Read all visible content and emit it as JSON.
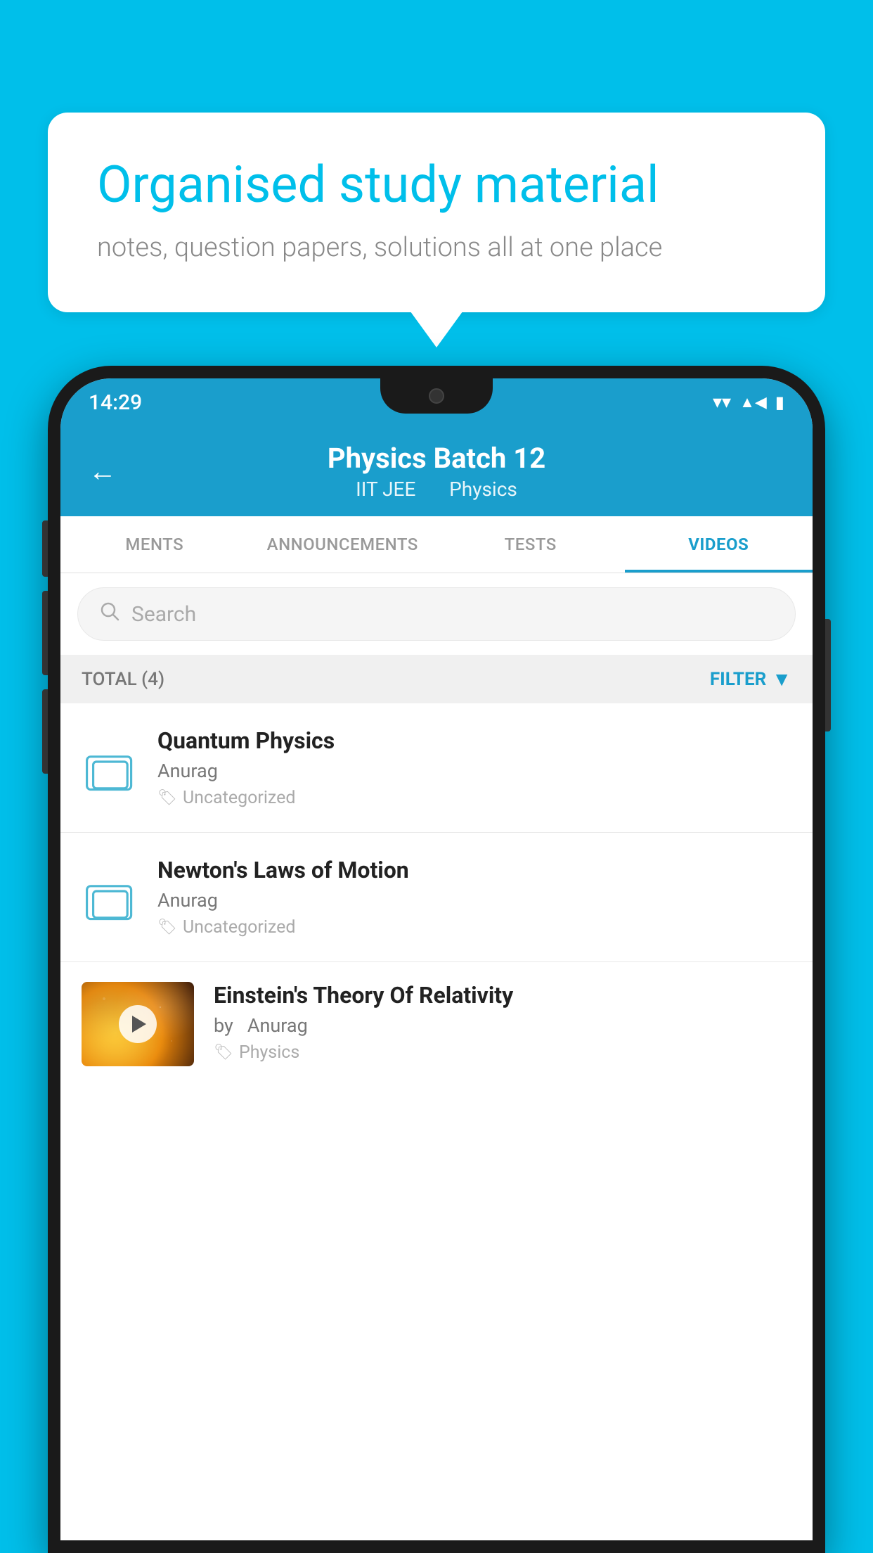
{
  "background_color": "#00BFEA",
  "bubble": {
    "title": "Organised study material",
    "subtitle": "notes, question papers, solutions all at one place"
  },
  "status_bar": {
    "time": "14:29",
    "wifi": "▼",
    "signal": "▲",
    "battery": "▮"
  },
  "header": {
    "back_label": "←",
    "title": "Physics Batch 12",
    "subtitle1": "IIT JEE",
    "subtitle2": "Physics"
  },
  "tabs": [
    {
      "label": "MENTS",
      "active": false
    },
    {
      "label": "ANNOUNCEMENTS",
      "active": false
    },
    {
      "label": "TESTS",
      "active": false
    },
    {
      "label": "VIDEOS",
      "active": true
    }
  ],
  "search": {
    "placeholder": "Search"
  },
  "list_header": {
    "total": "TOTAL (4)",
    "filter": "FILTER"
  },
  "videos": [
    {
      "id": 1,
      "title": "Quantum Physics",
      "author": "Anurag",
      "tag": "Uncategorized",
      "has_thumbnail": false
    },
    {
      "id": 2,
      "title": "Newton's Laws of Motion",
      "author": "Anurag",
      "tag": "Uncategorized",
      "has_thumbnail": false
    },
    {
      "id": 3,
      "title": "Einstein's Theory Of Relativity",
      "author_prefix": "by",
      "author": "Anurag",
      "tag": "Physics",
      "has_thumbnail": true
    }
  ]
}
